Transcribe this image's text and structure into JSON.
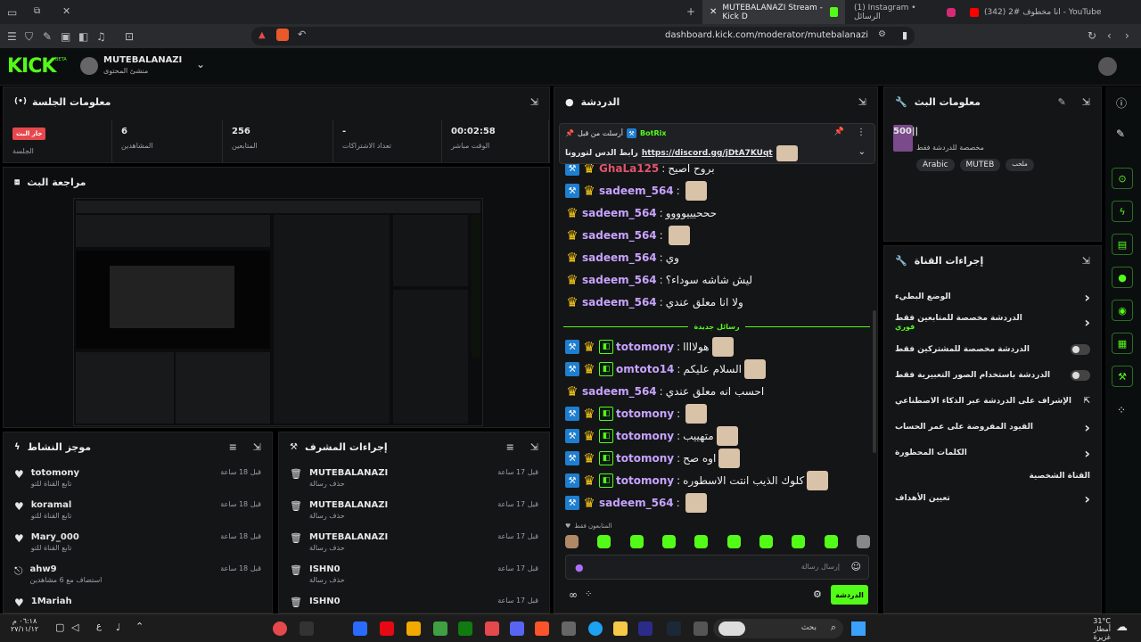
{
  "browser": {
    "tabs": [
      {
        "label": "(342) انا مخطوف #2 - YouTube"
      },
      {
        "label": "(1) Instagram • الرسائل"
      },
      {
        "label": "MUTEBALANAZI Stream - Kick D"
      }
    ],
    "new_tab": "+",
    "url": "dashboard.kick.com/moderator/mutebalanazi"
  },
  "kick": {
    "logo": "KICK",
    "beta": "BETA",
    "channel_name": "MUTEBALANAZI",
    "channel_role": "منشئ المحتوى"
  },
  "session": {
    "title": "معلومات الجلسة",
    "stats": [
      {
        "value": "00:02:58",
        "label": "الوقت مباشر"
      },
      {
        "value": "-",
        "label": "تعداد الاشتراكات"
      },
      {
        "value": "256",
        "label": "المتابعين"
      },
      {
        "value": "6",
        "label": "المشاهدين"
      }
    ],
    "live_badge": "جار البث",
    "live_label": "الجلسة"
  },
  "preview": {
    "title": "مراجعة البث"
  },
  "activity": {
    "title": "موجز النشاط",
    "items": [
      {
        "name": "totomony",
        "desc": "تابع القناة للتو",
        "time": "قبل 18 ساعة"
      },
      {
        "name": "koramal",
        "desc": "تابع القناة للتو",
        "time": "قبل 18 ساعة"
      },
      {
        "name": "Mary_000",
        "desc": "تابع القناة للتو",
        "time": "قبل 18 ساعة"
      },
      {
        "name": "ahw9",
        "desc": "استضاف مع 6 مشاهدين",
        "time": "قبل 18 ساعة"
      },
      {
        "name": "1Mariah",
        "desc": "",
        "time": ""
      }
    ]
  },
  "modactions": {
    "title": "إجراءات المشرف",
    "items": [
      {
        "name": "MUTEBALANAZI",
        "desc": "حذف رسالة",
        "time": "قبل 17 ساعة"
      },
      {
        "name": "MUTEBALANAZI",
        "desc": "حذف رسالة",
        "time": "قبل 17 ساعة"
      },
      {
        "name": "MUTEBALANAZI",
        "desc": "حذف رسالة",
        "time": "قبل 17 ساعة"
      },
      {
        "name": "ISHN0",
        "desc": "حذف رسالة",
        "time": "قبل 17 ساعة"
      },
      {
        "name": "ISHN0",
        "desc": "",
        "time": "قبل 17 ساعة"
      }
    ]
  },
  "chat": {
    "title": "الدردشة",
    "pinned": {
      "by": "أرسلت من قبل",
      "user": "BotRix",
      "text": "رابط الدس لتورونا",
      "link": "https://discord.gg/jDtA7KUqt"
    },
    "messages": [
      {
        "user": "GhaLa125",
        "text": "بروح اصيح",
        "color": "#e0556b",
        "badges": [
          "mod",
          "crown"
        ],
        "emote": false
      },
      {
        "user": "sadeem_564",
        "text": "",
        "color": "#c7a3ff",
        "badges": [
          "mod",
          "crown"
        ],
        "emote": true
      },
      {
        "user": "sadeem_564",
        "text": "حححيييوووو",
        "color": "#c7a3ff",
        "badges": [
          "crown"
        ],
        "emote": false
      },
      {
        "user": "sadeem_564",
        "text": "",
        "color": "#c7a3ff",
        "badges": [
          "crown"
        ],
        "emote": true
      },
      {
        "user": "sadeem_564",
        "text": "وي",
        "color": "#c7a3ff",
        "badges": [
          "crown"
        ],
        "emote": false
      },
      {
        "user": "sadeem_564",
        "text": "ليش شاشه سوداء؟",
        "color": "#c7a3ff",
        "badges": [
          "crown"
        ],
        "emote": false
      },
      {
        "user": "sadeem_564",
        "text": "ولا انا معلق عندي",
        "color": "#c7a3ff",
        "badges": [
          "crown"
        ],
        "emote": false
      }
    ],
    "new_messages": "رسائل جديدة",
    "messages2": [
      {
        "user": "totomony",
        "text": "هولاااا",
        "color": "#c7a3ff",
        "badges": [
          "mod",
          "crown",
          "sub"
        ],
        "emote": true
      },
      {
        "user": "omtoto14",
        "text": "السلام عليكم",
        "color": "#c7a3ff",
        "badges": [
          "mod",
          "crown",
          "sub"
        ],
        "emote": true
      },
      {
        "user": "sadeem_564",
        "text": "احسب انه معلق عندي",
        "color": "#c7a3ff",
        "badges": [
          "crown"
        ],
        "emote": false
      },
      {
        "user": "totomony",
        "text": "",
        "color": "#c7a3ff",
        "badges": [
          "mod",
          "crown",
          "sub"
        ],
        "emote": true
      },
      {
        "user": "totomony",
        "text": "متهييب",
        "color": "#c7a3ff",
        "badges": [
          "mod",
          "crown",
          "sub"
        ],
        "emote": true
      },
      {
        "user": "totomony",
        "text": "اوه صح",
        "color": "#c7a3ff",
        "badges": [
          "mod",
          "crown",
          "sub"
        ],
        "emote": true
      },
      {
        "user": "totomony",
        "text": "كلوك الذيب انتت الاسطوره",
        "color": "#c7a3ff",
        "badges": [
          "mod",
          "crown",
          "sub"
        ],
        "emote": true
      },
      {
        "user": "sadeem_564",
        "text": "",
        "color": "#c7a3ff",
        "badges": [
          "mod",
          "crown"
        ],
        "emote": true
      }
    ],
    "followers_only": "المتابعون فقط",
    "input_placeholder": "إرسال رسالة",
    "send_label": "الدردشة"
  },
  "streaminfo": {
    "title": "معلومات البث",
    "stream_title": "500‎|| ‎",
    "category": "مخصصة للدردشة فقط",
    "tags": [
      "Arabic",
      "MUTEB"
    ],
    "mature": "ملحب"
  },
  "channelactions": {
    "title": "إجراءات القناة",
    "items": [
      {
        "label": "الوضع البطيء",
        "sub": "",
        "control": "chevron"
      },
      {
        "label": "الدردشة مخصصة للمتابعين فقط",
        "sub": "فوري",
        "control": "chevron"
      },
      {
        "label": "الدردشة مخصصة للمشتركين فقط",
        "sub": "",
        "control": "toggle"
      },
      {
        "label": "الدردشة باستخدام الصور التعبيرية فقط",
        "sub": "",
        "control": "toggle"
      },
      {
        "label": "الإشراف على الدردشة عبر الذكاء الاصطناعي",
        "sub": "",
        "control": "ext"
      },
      {
        "label": "القيود المفروضة على عمر الحساب",
        "sub": "",
        "control": "chevron"
      },
      {
        "label": "الكلمات المحظورة",
        "sub": "",
        "control": "chevron"
      },
      {
        "label": "القناة الشخصية",
        "sub": "",
        "control": "none"
      },
      {
        "label": "تعيين الأهداف",
        "sub": "",
        "control": "chevron"
      }
    ]
  },
  "taskbar": {
    "search": "بحث",
    "weather_temp": "31°C",
    "weather_desc": "أمطار غزيرة",
    "lang": "ع",
    "time": "٠٦:١٨ م",
    "date": "٢٧/١١/١٢"
  },
  "colors": {
    "accent": "#53fc18",
    "panel": "#141517",
    "bg": "#000000"
  }
}
